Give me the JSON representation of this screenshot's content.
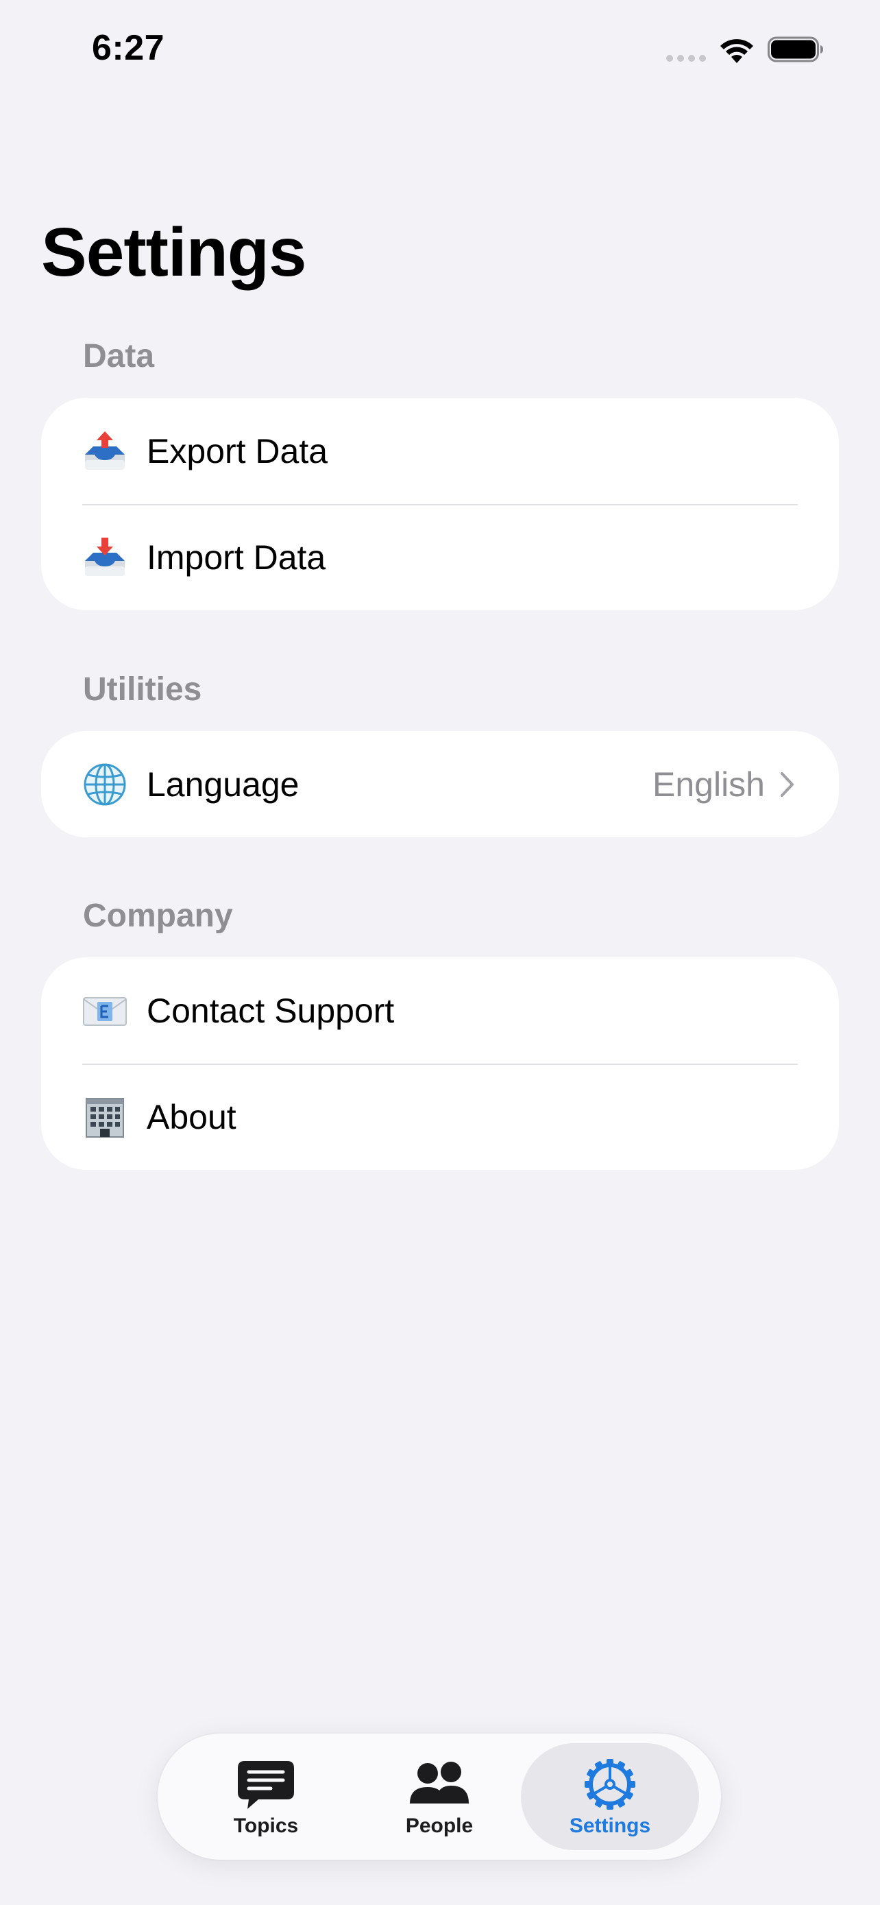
{
  "status_bar": {
    "time": "6:27"
  },
  "title": "Settings",
  "sections": [
    {
      "header": "Data",
      "rows": [
        {
          "label": "Export Data",
          "icon": "outbox-tray-icon"
        },
        {
          "label": "Import Data",
          "icon": "inbox-tray-icon"
        }
      ]
    },
    {
      "header": "Utilities",
      "rows": [
        {
          "label": "Language",
          "icon": "globe-icon",
          "value": "English"
        }
      ]
    },
    {
      "header": "Company",
      "rows": [
        {
          "label": "Contact Support",
          "icon": "email-icon"
        },
        {
          "label": "About",
          "icon": "office-building-icon"
        }
      ]
    }
  ],
  "tab_bar": {
    "tabs": [
      {
        "label": "Topics",
        "icon": "chat-bubble-icon",
        "active": false
      },
      {
        "label": "People",
        "icon": "people-icon",
        "active": false
      },
      {
        "label": "Settings",
        "icon": "gear-icon",
        "active": true
      }
    ]
  },
  "colors": {
    "accent": "#1f7ae0",
    "background": "#f2f2f7",
    "secondary_text": "#8e8e93"
  }
}
